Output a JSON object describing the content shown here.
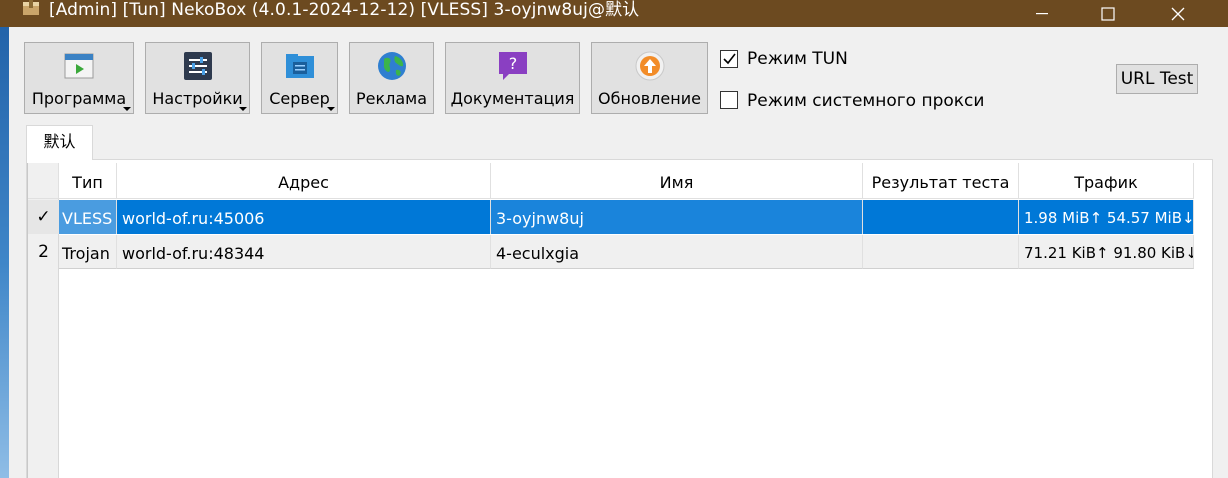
{
  "window": {
    "title": "[Admin] [Tun] NekoBox (4.0.1-2024-12-12) [VLESS] 3-oyjnw8uj@默认"
  },
  "toolbar": {
    "buttons": [
      {
        "label": "Программа",
        "icon": "program-icon",
        "dropdown": true
      },
      {
        "label": "Настройки",
        "icon": "settings-icon",
        "dropdown": true
      },
      {
        "label": "Сервер",
        "icon": "server-icon",
        "dropdown": true
      },
      {
        "label": "Реклама",
        "icon": "globe-icon",
        "dropdown": false
      },
      {
        "label": "Документация",
        "icon": "help-icon",
        "dropdown": false
      },
      {
        "label": "Обновление",
        "icon": "update-icon",
        "dropdown": false
      }
    ]
  },
  "options": {
    "tun_mode": {
      "label": "Режим TUN",
      "checked": true
    },
    "system_proxy": {
      "label": "Режим системного прокси",
      "checked": false
    }
  },
  "url_test": {
    "label": "URL Test"
  },
  "tabs": [
    {
      "label": "默认",
      "active": true
    }
  ],
  "table": {
    "columns": [
      "Тип",
      "Адрес",
      "Имя",
      "Результат теста",
      "Трафик"
    ],
    "rows": [
      {
        "row_label": "✓",
        "type": "VLESS",
        "address": "world-of.ru:45006",
        "name": "3-oyjnw8uj",
        "test_result": "",
        "traffic": "1.98 MiB↑ 54.57 MiB↓",
        "selected": true
      },
      {
        "row_label": "2",
        "type": "Trojan",
        "address": "world-of.ru:48344",
        "name": "4-eculxgia",
        "test_result": "",
        "traffic": "71.21 KiB↑ 91.80 KiB↓",
        "selected": false
      }
    ]
  },
  "colors": {
    "titlebar": "#6c4a20",
    "selection": "#0078d7",
    "window_bg": "#f0f0f0"
  }
}
